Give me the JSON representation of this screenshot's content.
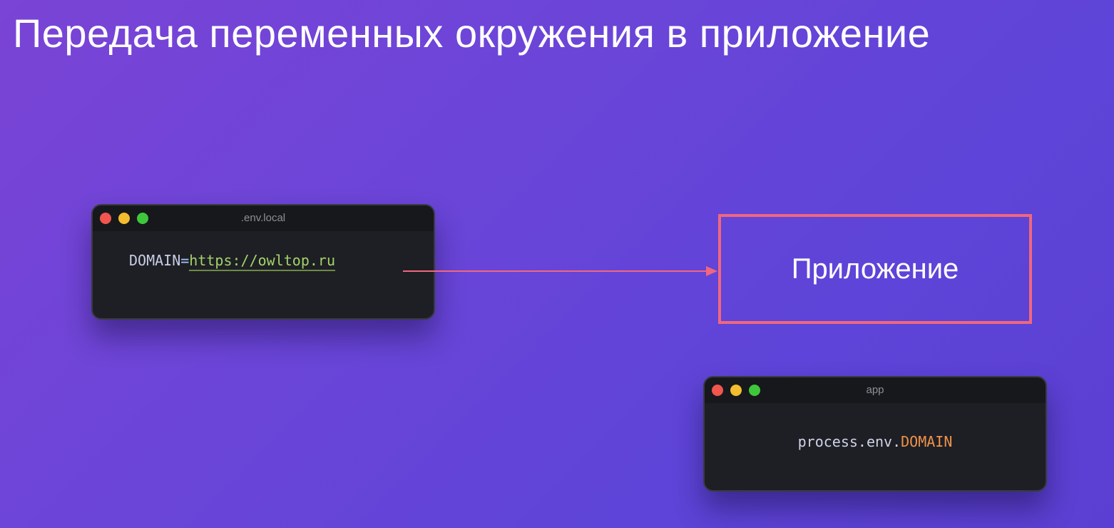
{
  "title": "Передача переменных окружения в приложение",
  "env_window": {
    "title": ".env.local",
    "code_key": "DOMAIN",
    "code_eq": "=",
    "code_value": "https://owltop.ru"
  },
  "app_box": {
    "label": "Приложение"
  },
  "app_window": {
    "title": "app",
    "code_obj": "process.env.",
    "code_prop": "DOMAIN"
  },
  "colors": {
    "background_start": "#7a44d6",
    "background_end": "#5b3fd2",
    "accent_box": "#f0677e",
    "url_green": "#a4d36a",
    "prop_orange": "#f0924a",
    "window_bg": "#1e1f24"
  }
}
